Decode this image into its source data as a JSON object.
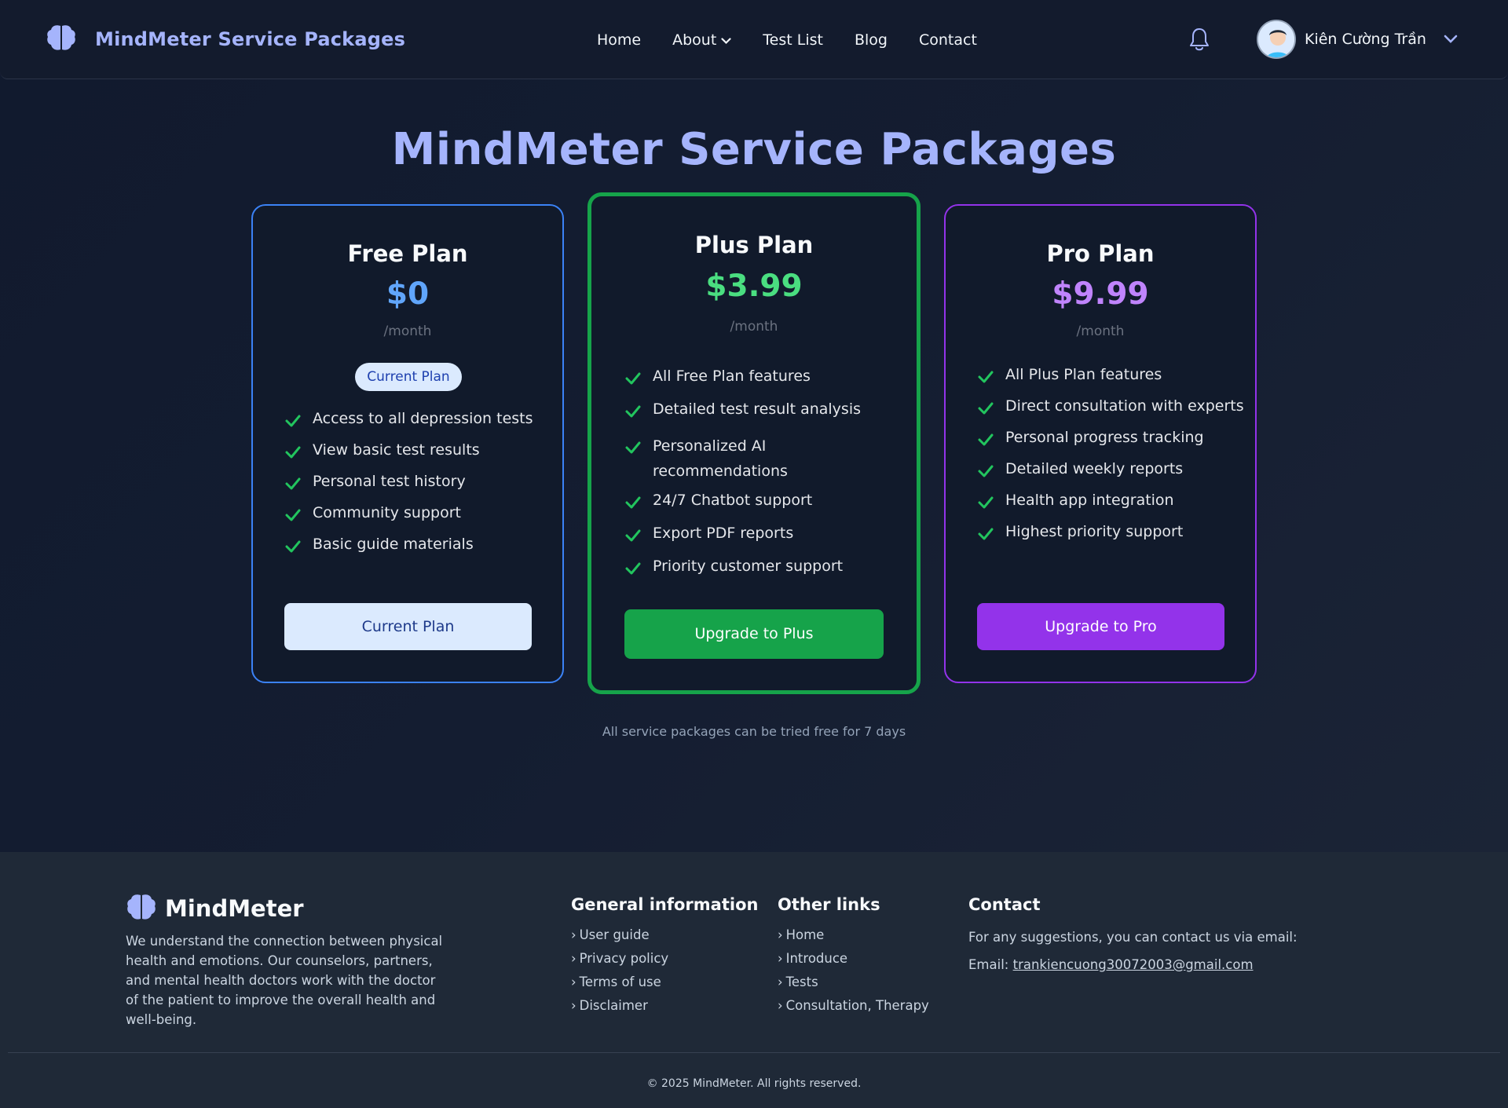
{
  "header": {
    "brand": "MindMeter Service Packages",
    "nav": [
      "Home",
      "About",
      "Test List",
      "Blog",
      "Contact"
    ],
    "user_name": "Kiên Cường Trần"
  },
  "page": {
    "title": "MindMeter Service Packages",
    "trial_note": "All service packages can be tried free for 7 days"
  },
  "plans": [
    {
      "name": "Free Plan",
      "price": "$0",
      "period": "/month",
      "badge": "Current Plan",
      "features": [
        "Access to all depression tests",
        "View basic test results",
        "Personal test history",
        "Community support",
        "Basic guide materials"
      ],
      "button": "Current Plan",
      "color": "#60a5fa"
    },
    {
      "name": "Plus Plan",
      "price": "$3.99",
      "period": "/month",
      "features": [
        "All Free Plan features",
        "Detailed test result analysis",
        "Personalized AI recommendations",
        "24/7 Chatbot support",
        "Export PDF reports",
        "Priority customer support"
      ],
      "button": "Upgrade to Plus",
      "color": "#4ade80"
    },
    {
      "name": "Pro Plan",
      "price": "$9.99",
      "period": "/month",
      "features": [
        "All Plus Plan features",
        "Direct consultation with experts",
        "Personal progress tracking",
        "Detailed weekly reports",
        "Health app integration",
        "Highest priority support"
      ],
      "button": "Upgrade to Pro",
      "color": "#c084fc"
    }
  ],
  "footer": {
    "brand": "MindMeter",
    "description": "We understand the connection between physical health and emotions. Our counselors, partners, and mental health doctors work with the doctor of the patient to improve the overall health and well-being.",
    "general": {
      "title": "General information",
      "links": [
        "User guide",
        "Privacy policy",
        "Terms of use",
        "Disclaimer"
      ]
    },
    "other": {
      "title": "Other links",
      "links": [
        "Home",
        "Introduce",
        "Tests",
        "Consultation, Therapy"
      ]
    },
    "contact": {
      "title": "Contact",
      "text": "For any suggestions, you can contact us via email:",
      "email_label": "Email:",
      "email": "trankiencuong30072003@gmail.com"
    },
    "copyright": "© 2025 MindMeter. All rights reserved."
  },
  "icons": {
    "brand": "brain-icon",
    "bell": "bell-icon",
    "check": "check-icon",
    "chevron": "chevron-down-icon"
  }
}
